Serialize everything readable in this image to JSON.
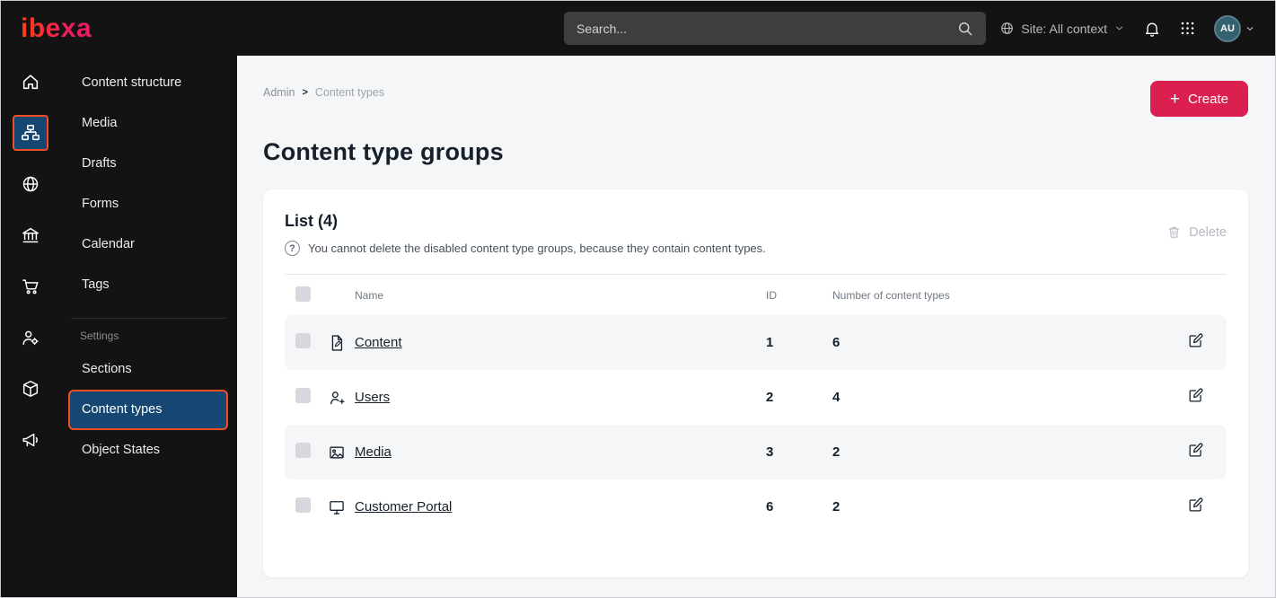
{
  "topbar": {
    "logo": "ibexa",
    "search": {
      "placeholder": "Search..."
    },
    "site_context_label": "Site: All context",
    "avatar_initials": "AU"
  },
  "icons": {
    "plus": "+",
    "question": "?",
    "breadcrumb_separator": ">"
  },
  "rail": {
    "icons": [
      "home-icon",
      "sitemap-icon",
      "globe-icon",
      "bank-icon",
      "cart-icon",
      "user-gear-icon",
      "package-icon",
      "megaphone-icon"
    ],
    "active_index": 1
  },
  "sidebar": {
    "items": [
      "Content structure",
      "Media",
      "Drafts",
      "Forms",
      "Calendar",
      "Tags"
    ],
    "settings_label": "Settings",
    "settings_items": [
      {
        "label": "Sections",
        "active": false
      },
      {
        "label": "Content types",
        "active": true
      },
      {
        "label": "Object States",
        "active": false
      }
    ]
  },
  "main": {
    "breadcrumb": [
      "Admin",
      "Content types"
    ],
    "create_label": "Create",
    "title": "Content type groups",
    "card": {
      "list_title": "List (4)",
      "info_text": "You cannot delete the disabled content type groups, because they contain content types.",
      "delete_label": "Delete",
      "table": {
        "headers": {
          "name": "Name",
          "id": "ID",
          "count": "Number of content types"
        },
        "rows": [
          {
            "icon": "file-icon",
            "name": "Content",
            "id": "1",
            "count": "6"
          },
          {
            "icon": "users-icon",
            "name": "Users",
            "id": "2",
            "count": "4"
          },
          {
            "icon": "image-icon",
            "name": "Media",
            "id": "3",
            "count": "2"
          },
          {
            "icon": "monitor-icon",
            "name": "Customer Portal",
            "id": "6",
            "count": "2"
          }
        ]
      }
    }
  },
  "colors": {
    "topbar_bg": "#131313",
    "accent_red": "#db2051",
    "selected_border": "#f14e24",
    "selected_bg": "#164672",
    "main_bg": "#f5f6f8",
    "text_dark": "#15202b"
  }
}
